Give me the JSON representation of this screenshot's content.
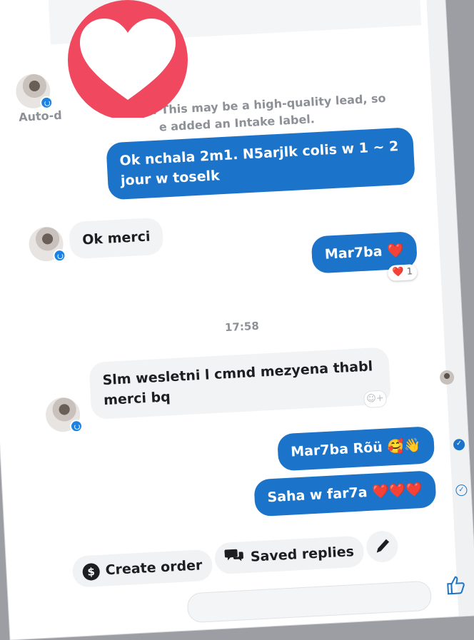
{
  "system_note": {
    "prefix": "Auto-d",
    "line1_visible": "e: This may be a high-quality lead, so",
    "line2_visible": "e added an Intake label."
  },
  "messages": [
    {
      "id": "m1",
      "dir": "out",
      "text": "Ok nchala 2m1. N5arjlk colis w 1 ~ 2 jour w toselk"
    },
    {
      "id": "m2",
      "dir": "in",
      "text": "Ok merci"
    },
    {
      "id": "m3",
      "dir": "out",
      "text": "Mar7ba",
      "emoji": "❤️",
      "reaction": {
        "emoji": "❤️",
        "count": "1"
      }
    },
    {
      "id": "m4",
      "dir": "in",
      "text": "Slm wesletni l cmnd mezyena thabl merci bq"
    },
    {
      "id": "m5",
      "dir": "out",
      "text": "Mar7ba Rõü",
      "emoji": "🥰👋"
    },
    {
      "id": "m6",
      "dir": "out",
      "text": "Saha w far7a",
      "emoji": "❤️❤️❤️"
    }
  ],
  "timestamp": "17:58",
  "actions": {
    "create_order": "Create order",
    "saved_replies": "Saved replies"
  },
  "icons": {
    "overlay": "heart-icon",
    "create_order": "dollar-icon",
    "saved_replies": "chat-bubbles-icon",
    "edit": "pencil-icon",
    "like": "thumbs-up-icon",
    "add_reaction": "smiley-plus-icon",
    "read_receipt": "check-icon"
  },
  "colors": {
    "outgoing_bubble": "#1b74c9",
    "incoming_bubble": "#f2f3f5",
    "heart": "#f0485e",
    "muted_text": "#8d9096"
  }
}
